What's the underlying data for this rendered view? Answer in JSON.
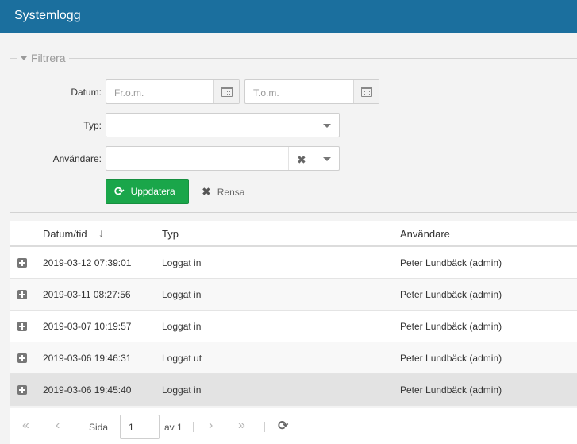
{
  "header": {
    "title": "Systemlogg"
  },
  "filter": {
    "legend": "Filtrera",
    "date_label": "Datum:",
    "date_from_placeholder": "Fr.o.m.",
    "date_to_placeholder": "T.o.m.",
    "type_label": "Typ:",
    "type_value": "",
    "user_label": "Användare:",
    "user_value": "",
    "update_label": "Uppdatera",
    "clear_label": "Rensa"
  },
  "table": {
    "columns": [
      "Datum/tid",
      "Typ",
      "Användare"
    ],
    "rows": [
      {
        "datetime": "2019-03-12 07:39:01",
        "type": "Loggat in",
        "user": "Peter Lundbäck (admin)"
      },
      {
        "datetime": "2019-03-11 08:27:56",
        "type": "Loggat in",
        "user": "Peter Lundbäck (admin)"
      },
      {
        "datetime": "2019-03-07 10:19:57",
        "type": "Loggat in",
        "user": "Peter Lundbäck (admin)"
      },
      {
        "datetime": "2019-03-06 19:46:31",
        "type": "Loggat ut",
        "user": "Peter Lundbäck (admin)"
      },
      {
        "datetime": "2019-03-06 19:45:40",
        "type": "Loggat in",
        "user": "Peter Lundbäck (admin)"
      }
    ]
  },
  "pager": {
    "page_label": "Sida",
    "page_value": "1",
    "of_label": "av 1"
  },
  "icons": {
    "calendar": "calendar-icon",
    "expand": "plus-square-icon",
    "refresh": "refresh-icon"
  },
  "colors": {
    "header": "#1b6f9e",
    "update_button": "#1aa64a"
  }
}
